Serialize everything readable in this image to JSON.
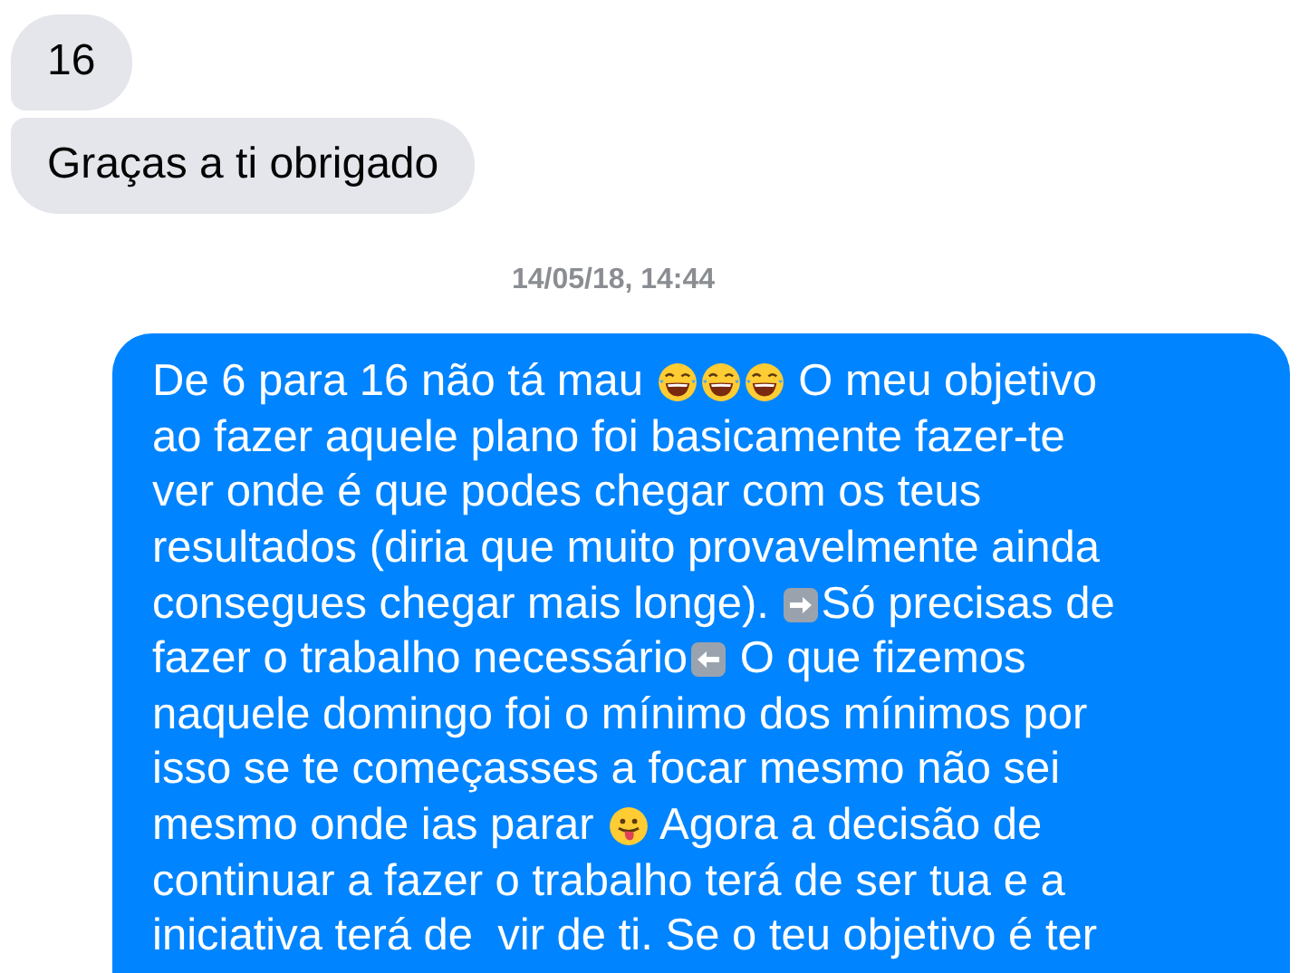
{
  "incoming_messages": [
    {
      "text": "16"
    },
    {
      "text": "Graças a ti obrigado"
    }
  ],
  "timestamp": "14/05/18, 14:44",
  "outgoing_message": {
    "lines": [
      [
        {
          "kind": "text",
          "text": "De 6 para 16 não tá mau "
        },
        {
          "kind": "laugh"
        },
        {
          "kind": "laugh"
        },
        {
          "kind": "laugh"
        },
        {
          "kind": "text",
          "text": " O meu objetivo"
        }
      ],
      [
        {
          "kind": "text",
          "text": "ao fazer aquele plano foi basicamente fazer-te"
        }
      ],
      [
        {
          "kind": "text",
          "text": "ver onde é que podes chegar com os teus"
        }
      ],
      [
        {
          "kind": "text",
          "text": "resultados (diria que muito provavelmente ainda"
        }
      ],
      [
        {
          "kind": "text",
          "text": "consegues chegar mais longe). "
        },
        {
          "kind": "arrow-right"
        },
        {
          "kind": "text",
          "text": "Só precisas de"
        }
      ],
      [
        {
          "kind": "text",
          "text": "fazer o trabalho necessário"
        },
        {
          "kind": "arrow-left"
        },
        {
          "kind": "text",
          "text": " O que fizemos"
        }
      ],
      [
        {
          "kind": "text",
          "text": "naquele domingo foi o mínimo dos mínimos por"
        }
      ],
      [
        {
          "kind": "text",
          "text": "isso se te começasses a focar mesmo não sei"
        }
      ],
      [
        {
          "kind": "text",
          "text": "mesmo onde ias parar "
        },
        {
          "kind": "tongue"
        },
        {
          "kind": "text",
          "text": " Agora a decisão de"
        }
      ],
      [
        {
          "kind": "text",
          "text": "continuar a fazer o trabalho terá de ser tua e a"
        }
      ],
      [
        {
          "kind": "text",
          "text": "iniciativa terá de  vir de ti. Se o teu objetivo é ter"
        }
      ]
    ]
  }
}
